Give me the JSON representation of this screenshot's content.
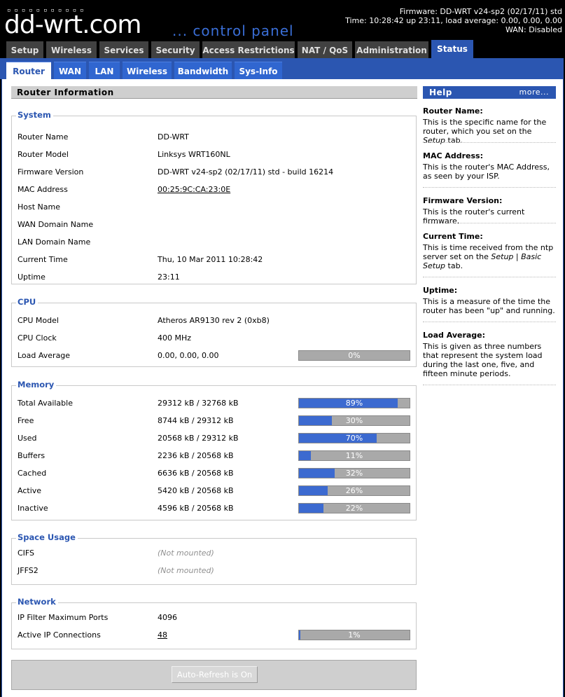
{
  "header": {
    "logo_dots": "▫▫▫▫▫▫▫▫▫▫▫",
    "logo_main": "dd-wrt",
    "logo_com": ".com",
    "control_panel": "... control panel",
    "firmware": "Firmware: DD-WRT v24-sp2 (02/17/11) std",
    "time": "Time: 10:28:42 up 23:11, load average: 0.00, 0.00, 0.00",
    "wan": "WAN: Disabled"
  },
  "main_tabs": [
    "Setup",
    "Wireless",
    "Services",
    "Security",
    "Access Restrictions",
    "NAT / QoS",
    "Administration",
    "Status"
  ],
  "sub_tabs": [
    "Router",
    "WAN",
    "LAN",
    "Wireless",
    "Bandwidth",
    "Sys-Info"
  ],
  "router_info": {
    "title": "Router Information",
    "system": {
      "legend": "System",
      "rows": [
        {
          "label": "Router Name",
          "value": "DD-WRT"
        },
        {
          "label": "Router Model",
          "value": "Linksys WRT160NL"
        },
        {
          "label": "Firmware Version",
          "value": "DD-WRT v24-sp2 (02/17/11) std - build 16214"
        },
        {
          "label": "MAC Address",
          "value": "00:25:9C:CA:23:0E"
        },
        {
          "label": "Host Name",
          "value": ""
        },
        {
          "label": "WAN Domain Name",
          "value": ""
        },
        {
          "label": "LAN Domain Name",
          "value": ""
        },
        {
          "label": "Current Time",
          "value": "Thu, 10 Mar 2011 10:28:42"
        },
        {
          "label": "Uptime",
          "value": "23:11"
        }
      ]
    },
    "cpu": {
      "legend": "CPU",
      "rows": [
        {
          "label": "CPU Model",
          "value": "Atheros AR9130 rev 2 (0xb8)"
        },
        {
          "label": "CPU Clock",
          "value": "400 MHz"
        },
        {
          "label": "Load Average",
          "value": "0.00, 0.00, 0.00",
          "pct_text": "0%",
          "pct": 0
        }
      ]
    },
    "memory": {
      "legend": "Memory",
      "rows": [
        {
          "label": "Total Available",
          "value": "29312 kB / 32768 kB",
          "pct_text": "89%",
          "pct": 89
        },
        {
          "label": "Free",
          "value": "8744 kB / 29312 kB",
          "pct_text": "30%",
          "pct": 30
        },
        {
          "label": "Used",
          "value": "20568 kB / 29312 kB",
          "pct_text": "70%",
          "pct": 70
        },
        {
          "label": "Buffers",
          "value": "2236 kB / 20568 kB",
          "pct_text": "11%",
          "pct": 11
        },
        {
          "label": "Cached",
          "value": "6636 kB / 20568 kB",
          "pct_text": "32%",
          "pct": 32
        },
        {
          "label": "Active",
          "value": "5420 kB / 20568 kB",
          "pct_text": "26%",
          "pct": 26
        },
        {
          "label": "Inactive",
          "value": "4596 kB / 20568 kB",
          "pct_text": "22%",
          "pct": 22
        }
      ]
    },
    "space": {
      "legend": "Space Usage",
      "rows": [
        {
          "label": "CIFS",
          "value": "(Not mounted)"
        },
        {
          "label": "JFFS2",
          "value": "(Not mounted)"
        }
      ]
    },
    "network": {
      "legend": "Network",
      "rows": [
        {
          "label": "IP Filter Maximum Ports",
          "value": "4096"
        },
        {
          "label": "Active IP Connections",
          "value": "48",
          "pct_text": "1%",
          "pct": 1
        }
      ]
    },
    "refresh_button": "Auto-Refresh is On"
  },
  "help": {
    "title": "Help",
    "more": "more...",
    "items": [
      {
        "title": "Router Name:",
        "desc_html": "This is the specific name for the router, which you set on the <i>Setup</i> tab."
      },
      {
        "title": "MAC Address:",
        "desc_html": "This is the router's MAC Address, as seen by your ISP."
      },
      {
        "title": "Firmware Version:",
        "desc_html": "This is the router's current firmware."
      },
      {
        "title": "Current Time:",
        "desc_html": "This is time received from the ntp server set on the <i>Setup | Basic Setup</i> tab."
      },
      {
        "title": "Uptime:",
        "desc_html": "This is a measure of the time the router has been \"up\" and running."
      },
      {
        "title": "Load Average:",
        "desc_html": "This is given as three numbers that represent the system load during the last one, five, and fifteen minute periods."
      }
    ]
  },
  "colors": {
    "accent": "#2b56b1",
    "bar_fill": "#3c6ad0",
    "bar_bg": "#a9a9a9"
  }
}
